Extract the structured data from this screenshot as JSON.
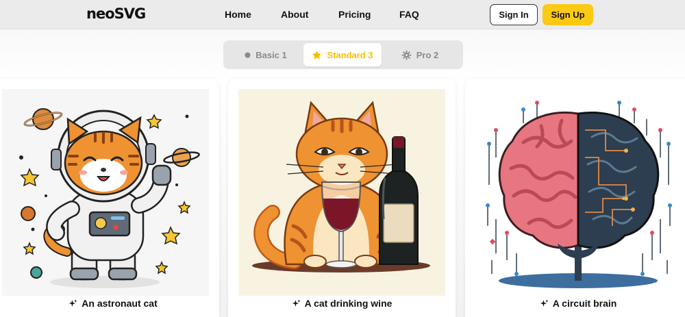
{
  "brand": {
    "logo": "neoSVG"
  },
  "nav": {
    "links": [
      "Home",
      "About",
      "Pricing",
      "FAQ"
    ],
    "sign_in": "Sign In",
    "sign_up": "Sign Up"
  },
  "tabs": [
    {
      "label": "Basic 1",
      "icon": "dot-icon",
      "active": false
    },
    {
      "label": "Standard 3",
      "icon": "star-icon",
      "active": true
    },
    {
      "label": "Pro 2",
      "icon": "gear-icon",
      "active": false
    }
  ],
  "cards": [
    {
      "caption": "An astronaut cat",
      "icon": "sparkle-icon",
      "image": "astronaut-cat-illustration"
    },
    {
      "caption": "A cat drinking wine",
      "icon": "sparkle-icon",
      "image": "cat-wine-illustration"
    },
    {
      "caption": "A circuit brain",
      "icon": "sparkle-icon",
      "image": "circuit-brain-illustration"
    }
  ],
  "colors": {
    "accent": "#fcc914",
    "active_tab_text": "#f5bf00",
    "inactive_tab_text": "#8a8a8a"
  }
}
